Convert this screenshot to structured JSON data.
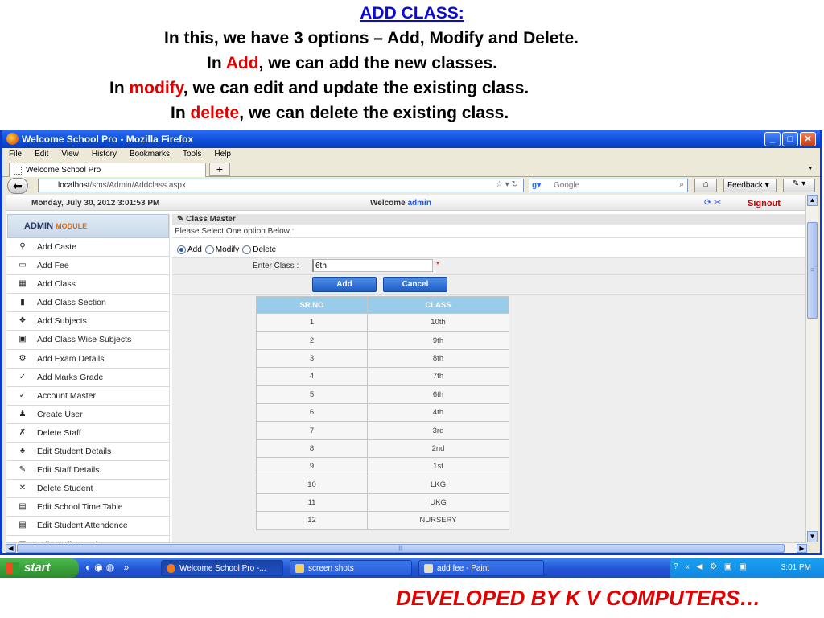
{
  "slide": {
    "title": "ADD CLASS:",
    "line1": "In this, we have 3 options – Add,  Modify and Delete.",
    "line2_pre": "In ",
    "line2_hl": "Add",
    "line2_post": ", we can add the new classes.",
    "line3_pre": "In ",
    "line3_hl": "modify",
    "line3_post": ", we can edit and update  the existing  class.",
    "line4_pre": "In ",
    "line4_hl": "delete",
    "line4_post": ", we can delete the existing class.",
    "footer": "DEVELOPED BY K V COMPUTERS…"
  },
  "window": {
    "title": "Welcome School Pro - Mozilla Firefox",
    "menu": [
      "File",
      "Edit",
      "View",
      "History",
      "Bookmarks",
      "Tools",
      "Help"
    ],
    "tab_title": "Welcome School Pro",
    "url_host": "localhost",
    "url_path": "/sms/Admin/Addclass.aspx",
    "search_placeholder": "Google",
    "feedback_label": "Feedback"
  },
  "page": {
    "datetime": "Monday, July 30, 2012    3:01:53 PM",
    "welcome_label": "Welcome ",
    "welcome_user": "admin",
    "signout": "Signout",
    "sidebar_title": "ADMIN",
    "sidebar_title_suffix": "MODULE",
    "sidebar_items": [
      {
        "label": "Add Caste",
        "icon": "caste-icon"
      },
      {
        "label": "Add Fee",
        "icon": "fee-icon"
      },
      {
        "label": "Add Class",
        "icon": "class-icon"
      },
      {
        "label": "Add Class Section",
        "icon": "section-icon"
      },
      {
        "label": "Add Subjects",
        "icon": "subjects-icon"
      },
      {
        "label": "Add Class Wise Subjects",
        "icon": "class-subjects-icon"
      },
      {
        "label": "Add Exam Details",
        "icon": "exam-icon"
      },
      {
        "label": "Add Marks Grade",
        "icon": "marks-icon"
      },
      {
        "label": "Account Master",
        "icon": "account-icon"
      },
      {
        "label": "Create User",
        "icon": "user-icon"
      },
      {
        "label": "Delete Staff",
        "icon": "delete-staff-icon"
      },
      {
        "label": "Edit Student Details",
        "icon": "edit-student-icon"
      },
      {
        "label": "Edit Staff Details",
        "icon": "edit-staff-icon"
      },
      {
        "label": "Delete Student",
        "icon": "delete-student-icon"
      },
      {
        "label": "Edit School Time Table",
        "icon": "timetable-icon"
      },
      {
        "label": "Edit Student Attendence",
        "icon": "attendance-icon"
      },
      {
        "label": "Edit Staff Attendence",
        "icon": "staff-attendance-icon"
      }
    ],
    "panel_title": "Class Master",
    "panel_subtitle": "Please Select One option Below :",
    "options": [
      {
        "label": "Add",
        "checked": true
      },
      {
        "label": "Modify",
        "checked": false
      },
      {
        "label": "Delete",
        "checked": false
      }
    ],
    "class_label": "Enter Class :",
    "class_value": "6th",
    "required_mark": "*",
    "add_button": "Add",
    "cancel_button": "Cancel",
    "table_headers": [
      "SR.NO",
      "CLASS"
    ],
    "table_rows": [
      [
        "1",
        "10th"
      ],
      [
        "2",
        "9th"
      ],
      [
        "3",
        "8th"
      ],
      [
        "4",
        "7th"
      ],
      [
        "5",
        "6th"
      ],
      [
        "6",
        "4th"
      ],
      [
        "7",
        "3rd"
      ],
      [
        "8",
        "2nd"
      ],
      [
        "9",
        "1st"
      ],
      [
        "10",
        "LKG"
      ],
      [
        "11",
        "UKG"
      ],
      [
        "12",
        "NURSERY"
      ]
    ]
  },
  "taskbar": {
    "start": "start",
    "tasks": [
      "Welcome School Pro -...",
      "screen shots",
      "add fee - Paint"
    ],
    "clock": "3:01 PM"
  }
}
